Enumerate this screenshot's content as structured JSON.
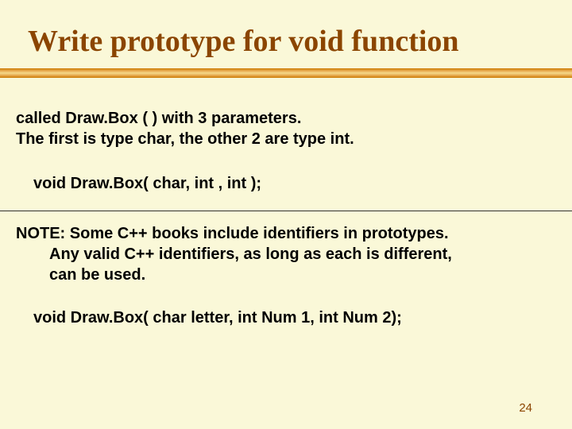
{
  "slide": {
    "title": "Write prototype for void function",
    "para1_line1": "called  Draw.Box ( ) with 3 parameters.",
    "para1_line2": "The first is type char,  the other 2 are type int.",
    "code1": "void Draw.Box( char, int , int );",
    "note_line1": "NOTE:  Some C++ books include identifiers in prototypes.",
    "note_line2": "Any valid C++ identifiers, as long as each is different,",
    "note_line3": "can be used.",
    "code2": "void Draw.Box( char letter, int Num 1, int Num 2);",
    "page_number": "24"
  }
}
